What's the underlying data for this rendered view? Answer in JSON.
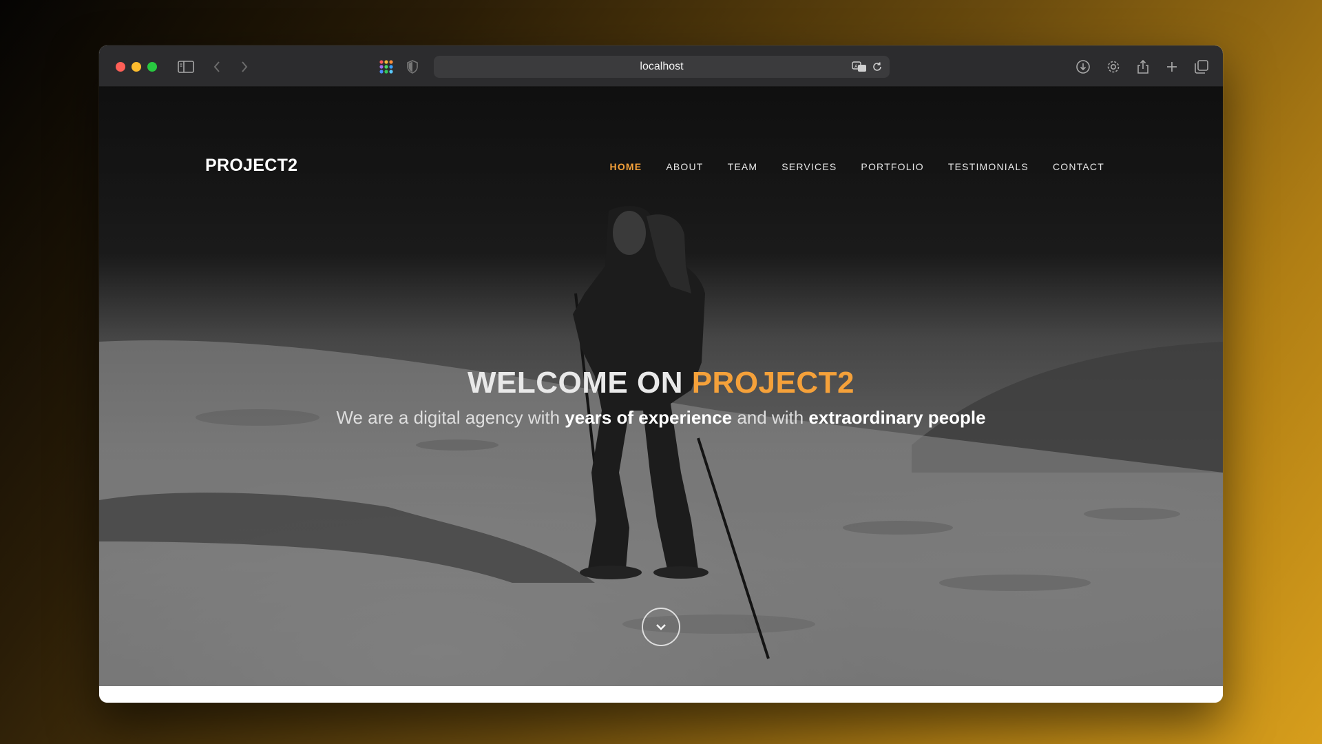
{
  "browser": {
    "url": "localhost",
    "icons": [
      "sidebar-icon",
      "back-icon",
      "forward-icon",
      "extensions-grid-icon",
      "shield-icon",
      "translate-icon",
      "reload-icon",
      "download-icon",
      "settings-icon",
      "share-icon",
      "new-tab-icon",
      "tabs-overview-icon"
    ]
  },
  "site": {
    "brand": "PROJECT2",
    "nav": [
      {
        "label": "HOME",
        "active": true
      },
      {
        "label": "ABOUT"
      },
      {
        "label": "TEAM"
      },
      {
        "label": "SERVICES"
      },
      {
        "label": "PORTFOLIO"
      },
      {
        "label": "TESTIMONIALS"
      },
      {
        "label": "CONTACT"
      }
    ],
    "hero": {
      "title_prefix": "WELCOME ON ",
      "title_accent": "PROJECT2",
      "subtitle_1": "We are a digital agency with ",
      "subtitle_bold_1": "years of experience",
      "subtitle_2": " and with ",
      "subtitle_bold_2": "extraordinary people"
    },
    "scroll_icon": "chevron-down-icon"
  },
  "colors": {
    "accent": "#f5a13a",
    "toolbar": "#2c2c2e"
  }
}
